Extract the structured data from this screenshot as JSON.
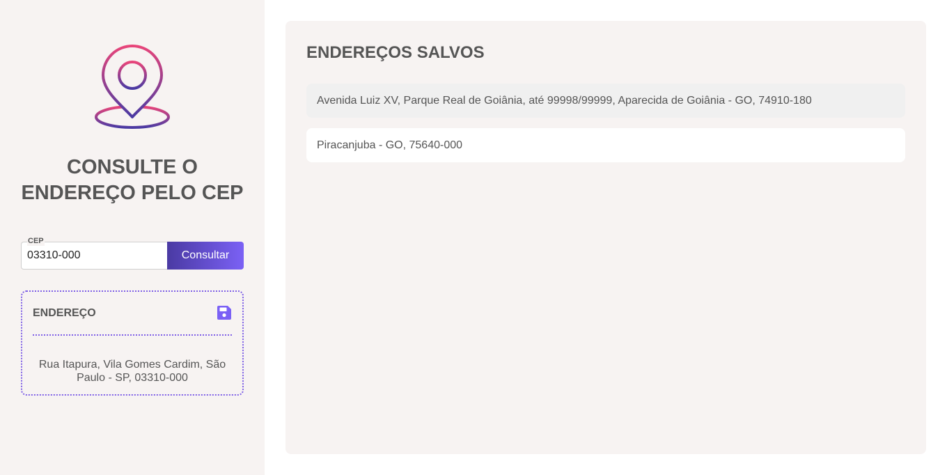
{
  "sidebar": {
    "logo_icon": "map-pin-icon",
    "heading_line1": "CONSULTE O",
    "heading_line2": "ENDEREÇO PELO CEP",
    "cep_label": "CEP",
    "cep_value": "03310-000",
    "consult_button": "Consultar",
    "card": {
      "title": "ENDEREÇO",
      "save_icon": "floppy-disk-icon",
      "address": "Rua Itapura, Vila Gomes Cardim, São Paulo - SP, 03310-000"
    }
  },
  "main": {
    "title": "ENDEREÇOS SALVOS",
    "saved_addresses": [
      "Avenida Luiz XV, Parque Real de Goiânia, até 99998/99999, Aparecida de Goiânia - GO, 74910-180",
      "Piracanjuba - GO, 75640-000"
    ]
  },
  "colors": {
    "sidebar_bg": "#f7f3f2",
    "accent": "#7b61f5",
    "accent_dark": "#4a3aa3",
    "logo_gradient_top": "#e8457a",
    "logo_gradient_bottom": "#4a3aa3",
    "text": "#555555"
  }
}
